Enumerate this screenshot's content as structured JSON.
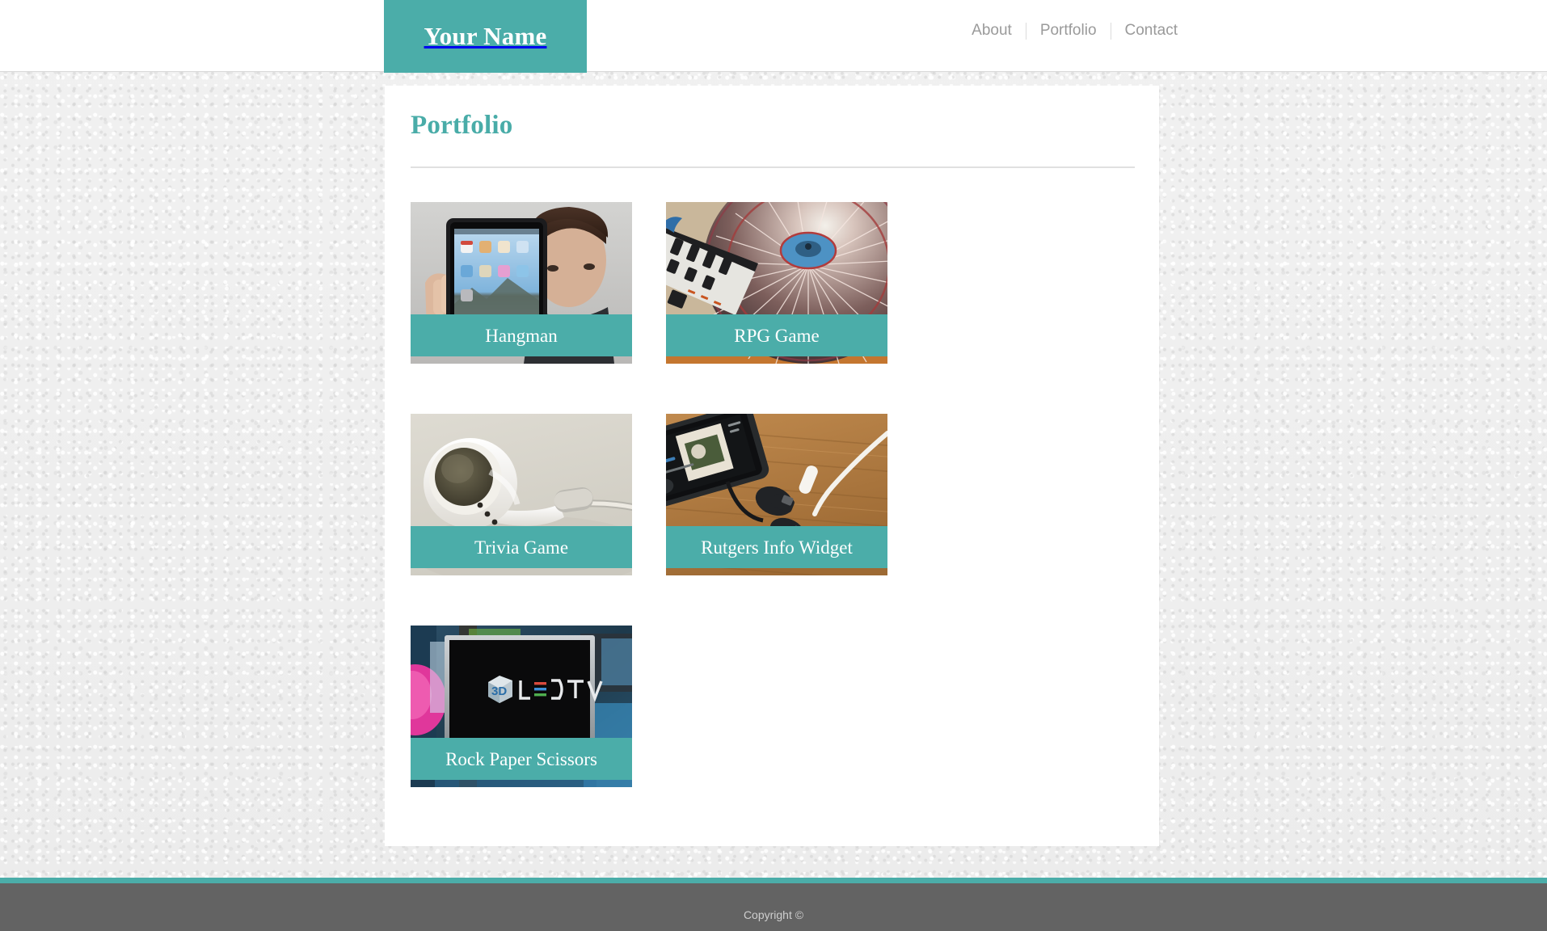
{
  "header": {
    "logo_text": "Your Name",
    "nav": [
      {
        "label": "About"
      },
      {
        "label": "Portfolio"
      },
      {
        "label": "Contact"
      }
    ]
  },
  "main": {
    "page_title": "Portfolio",
    "portfolio_items": [
      {
        "label": "Hangman",
        "thumb": "tablet-in-hands-photo"
      },
      {
        "label": "RPG Game",
        "thumb": "dj-mixer-turntable-photo"
      },
      {
        "label": "Trivia Game",
        "thumb": "white-earbud-photo"
      },
      {
        "label": "Rutgers Info Widget",
        "thumb": "smartphone-earbuds-desk-photo"
      },
      {
        "label": "Rock Paper Scissors",
        "thumb": "led-tv-display-photo"
      }
    ]
  },
  "footer": {
    "copyright": "Copyright ©"
  },
  "colors": {
    "accent_teal": "#4bada9",
    "heading_teal": "#49aca8",
    "nav_gray": "#9a9a9a",
    "footer_gray": "#636363",
    "page_bg": "#efefef",
    "card_bg": "#ffffff"
  }
}
